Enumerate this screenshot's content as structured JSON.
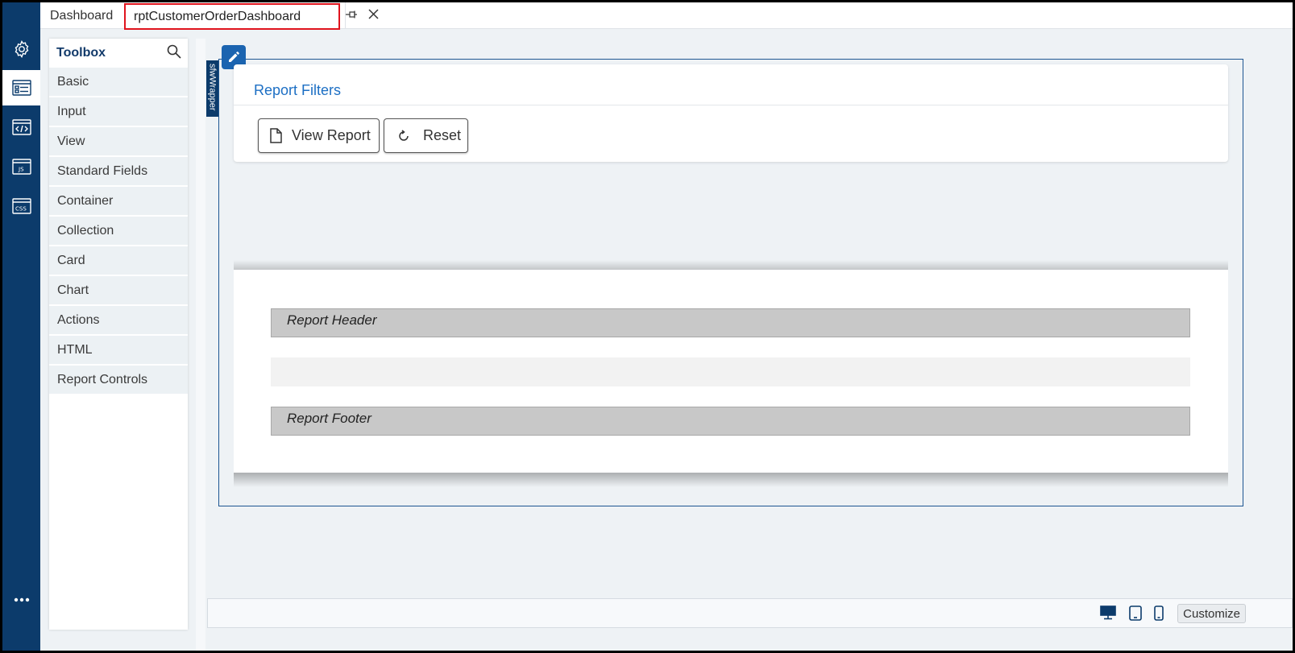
{
  "tabs": {
    "dashboard": "Dashboard",
    "active": "rptCustomerOrderDashboard"
  },
  "rail": {
    "items": [
      "settings-icon",
      "form-designer-icon",
      "code-icon",
      "js-icon",
      "css-icon"
    ],
    "more": "more-icon"
  },
  "toolbox": {
    "title": "Toolbox",
    "items": [
      "Basic",
      "Input",
      "View",
      "Standard Fields",
      "Container",
      "Collection",
      "Card",
      "Chart",
      "Actions",
      "HTML",
      "Report Controls"
    ]
  },
  "canvas": {
    "wrapper_label": "sfwWrapper",
    "filters_title": "Report Filters",
    "view_report": "View Report",
    "reset": "Reset",
    "report_header": "Report Header",
    "report_footer": "Report Footer"
  },
  "statusbar": {
    "devices": [
      "desktop-icon",
      "tablet-icon",
      "mobile-icon"
    ],
    "customize": "Customize"
  },
  "colors": {
    "rail": "#0c3b6b",
    "accent": "#1d6fc4",
    "highlight": "#e0141e"
  }
}
